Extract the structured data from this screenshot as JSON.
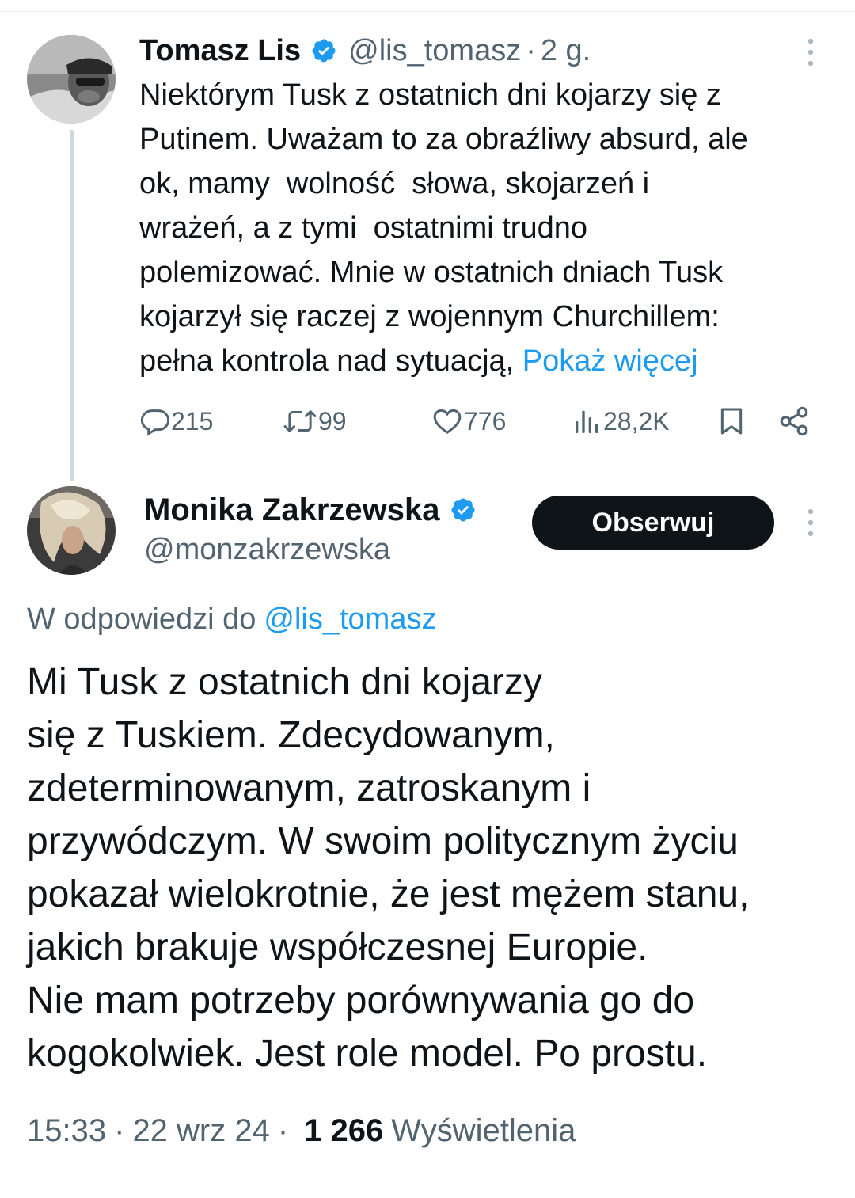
{
  "parent_tweet": {
    "author_name": "Tomasz Lis",
    "handle": "@lis_tomasz",
    "separator": "·",
    "time_ago": "2 g.",
    "verified": true,
    "body_lines": [
      "Niektórym Tusk z ostatnich dni kojarzy się z",
      "Putinem. Uważam to za obraźliwy absurd, ale",
      "ok, mamy  wolność  słowa, skojarzeń i",
      "wrażeń, a z tymi  ostatnimi trudno",
      "polemizować. Mnie w ostatnich dniach Tusk",
      "kojarzył się raczej z wojennym Churchillem:",
      "pełna kontrola nad sytuacją, "
    ],
    "show_more_label": "Pokaż więcej",
    "stats": {
      "replies": "215",
      "reposts": "99",
      "likes": "776",
      "views": "28,2K"
    },
    "icons": {
      "reply": "reply-icon",
      "repost": "repost-icon",
      "like": "heart-icon",
      "views": "views-icon",
      "bookmark": "bookmark-icon",
      "share": "share-icon",
      "more": "more-icon"
    }
  },
  "reply_tweet": {
    "author_name": "Monika Zakrzewska",
    "handle": "@monzakrzewska",
    "verified": true,
    "follow_label": "Obserwuj",
    "reply_to_label": "W odpowiedzi do",
    "reply_to_handle": "@lis_tomasz",
    "body_lines": [
      "Mi Tusk z ostatnich dni kojarzy",
      "się z Tuskiem. Zdecydowanym,",
      "zdeterminowanym, zatroskanym i",
      "przywódczym. W swoim politycznym życiu",
      "pokazał wielokrotnie, że jest mężem stanu,",
      "jakich brakuje współczesnej Europie.",
      "Nie mam potrzeby porównywania go do",
      "kogokolwiek. Jest role model. Po prostu."
    ],
    "time": "15:33",
    "date": "22 wrz 24",
    "separator": "·",
    "views_count": "1 266",
    "views_label": "Wyświetlenia"
  },
  "colors": {
    "accent": "#1d9bf0",
    "text_primary": "#0f1419",
    "text_secondary": "#536471",
    "follow_button_bg": "#0f1419",
    "thread_line": "#cfd9de"
  }
}
